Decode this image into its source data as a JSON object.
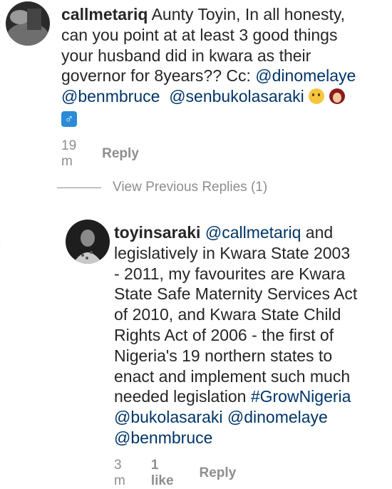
{
  "comments": [
    {
      "username": "callmetariq",
      "lines": [
        " Aunty Toyin, In all honesty,",
        "can you point at at least 3 good things",
        "your husband did in kwara as their",
        "governor for 8years?? Cc: "
      ],
      "mentions": [
        "@dinomelaye",
        "@benmbruce",
        "@senbukolasaraki"
      ],
      "male_sign": "♂",
      "time": "19 m",
      "reply_label": "Reply"
    },
    {
      "username": "toyinsaraki",
      "mention_first": "@callmetariq",
      "after_mention": " and",
      "lines": [
        "legislatively in Kwara State 2003",
        "- 2011, my favourites are Kwara",
        "State Safe Maternity Services Act",
        "of 2010, and Kwara State Child",
        "Rights Act of 2006 - the first of",
        "Nigeria's 19 northern states to",
        "enact and implement such much",
        "needed legislation "
      ],
      "hashtag": "#GrowNigeria",
      "mentions": [
        "@bukolasaraki",
        "@dinomelaye",
        "@benmbruce"
      ],
      "time": "3 m",
      "likes": "1 like",
      "reply_label": "Reply"
    }
  ],
  "view_previous": "View Previous Replies (1)",
  "icons": {
    "heart": "heart-outline-icon",
    "thinking": "thinking-face-emoji",
    "woman": "woman-emoji"
  },
  "colors": {
    "text": "#262626",
    "secondary": "#8e8e8e",
    "link": "#003569"
  }
}
